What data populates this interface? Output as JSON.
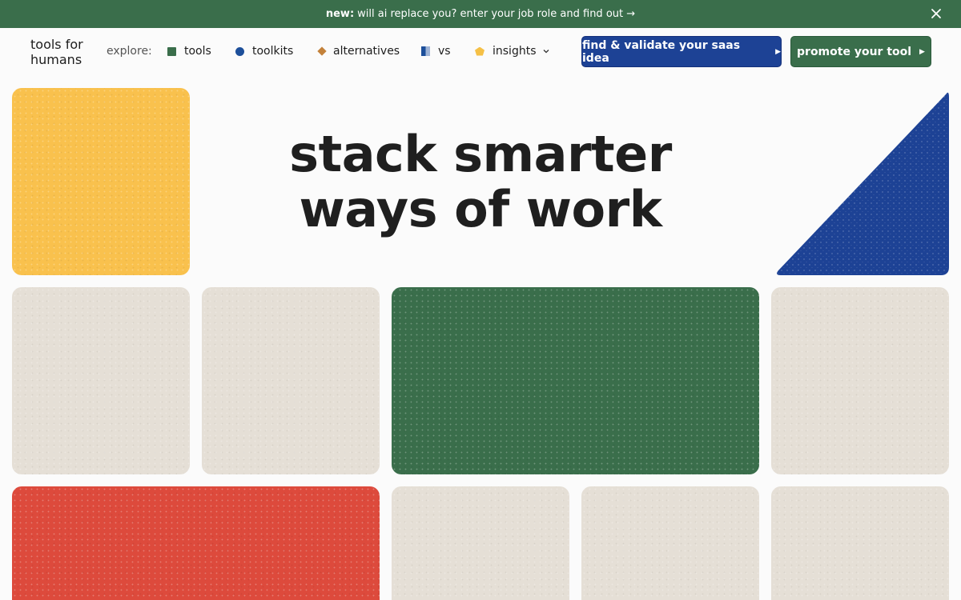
{
  "banner": {
    "prefix": "new:",
    "text": "will ai replace you? enter your job role and find out →"
  },
  "logo": {
    "line1": "tools for",
    "line2": "humans"
  },
  "nav": {
    "explore_label": "explore:",
    "items": [
      {
        "label": "tools",
        "icon": "green-square-icon"
      },
      {
        "label": "toolkits",
        "icon": "blue-circle-icon"
      },
      {
        "label": "alternatives",
        "icon": "orange-diamond-icon"
      },
      {
        "label": "vs",
        "icon": "blue-flag-icon"
      },
      {
        "label": "insights",
        "icon": "yellow-pentagon-icon"
      }
    ]
  },
  "buttons": {
    "validate": "find & validate your saas idea",
    "promote": "promote your tool"
  },
  "hero": {
    "line1": "stack smarter",
    "line2": "ways of work"
  },
  "colors": {
    "green": "#3a6e4b",
    "blue": "#1d4295",
    "yellow": "#f9c14d",
    "red": "#dd4a3c",
    "beige": "#e5dfd6"
  }
}
